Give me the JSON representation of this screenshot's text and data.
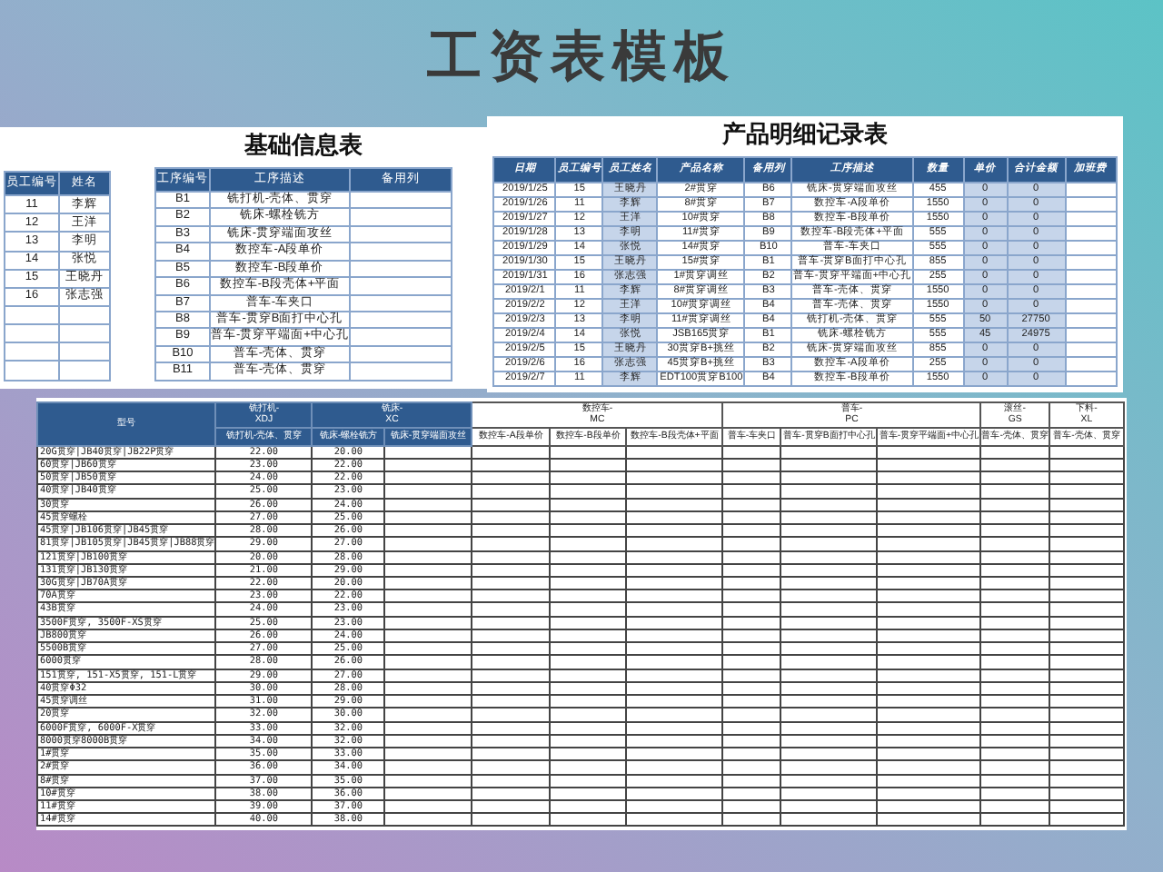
{
  "title": "工资表模板",
  "basic_info": {
    "title": "基础信息表",
    "employees": {
      "columns": [
        "员工编号",
        "姓名"
      ],
      "rows": [
        [
          "11",
          "李辉"
        ],
        [
          "12",
          "王洋"
        ],
        [
          "13",
          "李明"
        ],
        [
          "14",
          "张悦"
        ],
        [
          "15",
          "王晓丹"
        ],
        [
          "16",
          "张志强"
        ]
      ]
    },
    "processes": {
      "columns": [
        "工序编号",
        "工序描述",
        "备用列"
      ],
      "rows": [
        [
          "B1",
          "铣打机-壳体、贯穿"
        ],
        [
          "B2",
          "铣床-螺栓铣方"
        ],
        [
          "B3",
          "铣床-贯穿端面攻丝"
        ],
        [
          "B4",
          "数控车-A段单价"
        ],
        [
          "B5",
          "数控车-B段单价"
        ],
        [
          "B6",
          "数控车-B段壳体+平面"
        ],
        [
          "B7",
          "普车-车夹口"
        ],
        [
          "B8",
          "普车-贯穿B面打中心孔"
        ],
        [
          "B9",
          "普车-贯穿平端面+中心孔"
        ],
        [
          "B10",
          "普车-壳体、贯穿"
        ],
        [
          "B11",
          "普车-壳体、贯穿"
        ]
      ]
    }
  },
  "product_log": {
    "title": "产品明细记录表",
    "columns": [
      {
        "label": "日期",
        "highlight": false
      },
      {
        "label": "员工编号",
        "highlight": false
      },
      {
        "label": "员工姓名",
        "highlight": true
      },
      {
        "label": "产品名称",
        "highlight": false
      },
      {
        "label": "备用列",
        "highlight": false
      },
      {
        "label": "工序描述",
        "highlight": false
      },
      {
        "label": "数量",
        "highlight": false
      },
      {
        "label": "单价",
        "highlight": true
      },
      {
        "label": "合计金额",
        "highlight": true
      },
      {
        "label": "加班费",
        "highlight": false
      }
    ],
    "rows": [
      [
        "2019/1/25",
        "15",
        "王晓丹",
        "2#贯穿",
        "B6",
        "铣床-贯穿端面攻丝",
        "455",
        "0",
        "0"
      ],
      [
        "2019/1/26",
        "11",
        "李辉",
        "8#贯穿",
        "B7",
        "数控车-A段单价",
        "1550",
        "0",
        "0"
      ],
      [
        "2019/1/27",
        "12",
        "王洋",
        "10#贯穿",
        "B8",
        "数控车-B段单价",
        "1550",
        "0",
        "0"
      ],
      [
        "2019/1/28",
        "13",
        "李明",
        "11#贯穿",
        "B9",
        "数控车-B段壳体+平面",
        "555",
        "0",
        "0"
      ],
      [
        "2019/1/29",
        "14",
        "张悦",
        "14#贯穿",
        "B10",
        "普车-车夹口",
        "555",
        "0",
        "0"
      ],
      [
        "2019/1/30",
        "15",
        "王晓丹",
        "15#贯穿",
        "B1",
        "普车-贯穿B面打中心孔",
        "855",
        "0",
        "0"
      ],
      [
        "2019/1/31",
        "16",
        "张志强",
        "1#贯穿调丝",
        "B2",
        "普车-贯穿平端面+中心孔",
        "255",
        "0",
        "0"
      ],
      [
        "2019/2/1",
        "11",
        "李辉",
        "8#贯穿调丝",
        "B3",
        "普车-壳体、贯穿",
        "1550",
        "0",
        "0"
      ],
      [
        "2019/2/2",
        "12",
        "王洋",
        "10#贯穿调丝",
        "B4",
        "普车-壳体、贯穿",
        "1550",
        "0",
        "0"
      ],
      [
        "2019/2/3",
        "13",
        "李明",
        "11#贯穿调丝",
        "B4",
        "铣打机-壳体、贯穿",
        "555",
        "50",
        "27750"
      ],
      [
        "2019/2/4",
        "14",
        "张悦",
        "JSB165贯穿",
        "B1",
        "铣床-螺栓铣方",
        "555",
        "45",
        "24975"
      ],
      [
        "2019/2/5",
        "15",
        "王晓丹",
        "30贯穿B+挑丝",
        "B2",
        "铣床-贯穿端面攻丝",
        "855",
        "0",
        "0"
      ],
      [
        "2019/2/6",
        "16",
        "张志强",
        "45贯穿B+挑丝",
        "B3",
        "数控车-A段单价",
        "255",
        "0",
        "0"
      ],
      [
        "2019/2/7",
        "11",
        "李辉",
        "EDT100贯穿B100",
        "B4",
        "数控车-B段单价",
        "1550",
        "0",
        "0"
      ]
    ]
  },
  "price_table": {
    "model_header": "型号",
    "groups": [
      {
        "name": "铣打机-",
        "code": "XDJ",
        "kind": "dark",
        "columns": [
          "铣打机-壳体、贯穿"
        ]
      },
      {
        "name": "铣床-",
        "code": "XC",
        "kind": "dark",
        "columns": [
          "铣床-螺栓铣方",
          "铣床-贯穿端面攻丝"
        ]
      },
      {
        "name": "数控车-",
        "code": "MC",
        "kind": "light",
        "columns": [
          "数控车-A段单价",
          "数控车-B段单价",
          "数控车-B段壳体+平面"
        ]
      },
      {
        "name": "普车-",
        "code": "PC",
        "kind": "light",
        "columns": [
          "普车-车夹口",
          "普车-贯穿B面打中心孔",
          "普车-贯穿平端面+中心孔"
        ]
      },
      {
        "name": "滚丝-",
        "code": "GS",
        "kind": "light",
        "columns": [
          "普车-壳体、贯穿"
        ]
      },
      {
        "name": "下料-",
        "code": "XL",
        "kind": "light",
        "columns": [
          "普车-壳体、贯穿"
        ]
      }
    ],
    "rows": [
      {
        "model": "20G贯穿|JB40贯穿|JB22P贯穿",
        "values": [
          "22.00",
          "20.00"
        ]
      },
      {
        "model": "60贯穿|JB60贯穿",
        "values": [
          "23.00",
          "22.00"
        ]
      },
      {
        "model": "50贯穿|JB50贯穿",
        "values": [
          "24.00",
          "22.00"
        ]
      },
      {
        "model": "40贯穿|JB40贯穿",
        "values": [
          "25.00",
          "23.00"
        ]
      },
      {
        "model": "30贯穿",
        "values": [
          "26.00",
          "24.00"
        ]
      },
      {
        "model": "45贯穿螺栓",
        "values": [
          "27.00",
          "25.00"
        ]
      },
      {
        "model": "45贯穿|JB106贯穿|JB45贯穿",
        "values": [
          "28.00",
          "26.00"
        ]
      },
      {
        "model": "81贯穿|JB105贯穿|JB45贯穿|JB88贯穿",
        "values": [
          "29.00",
          "27.00"
        ]
      },
      {
        "model": "121贯穿|JB100贯穿",
        "values": [
          "20.00",
          "28.00"
        ]
      },
      {
        "model": "131贯穿|JB130贯穿",
        "values": [
          "21.00",
          "29.00"
        ]
      },
      {
        "model": "30G贯穿|JB70A贯穿",
        "values": [
          "22.00",
          "20.00"
        ]
      },
      {
        "model": "70A贯穿",
        "values": [
          "23.00",
          "22.00"
        ]
      },
      {
        "model": "43B贯穿",
        "values": [
          "24.00",
          "23.00"
        ]
      },
      {
        "model": "3500F贯穿, 3500F-XS贯穿",
        "values": [
          "25.00",
          "23.00"
        ]
      },
      {
        "model": "JB800贯穿",
        "values": [
          "26.00",
          "24.00"
        ]
      },
      {
        "model": "5500B贯穿",
        "values": [
          "27.00",
          "25.00"
        ]
      },
      {
        "model": "6000贯穿",
        "values": [
          "28.00",
          "26.00"
        ]
      },
      {
        "model": "151贯穿, 151-X5贯穿, 151-L贯穿",
        "values": [
          "29.00",
          "27.00"
        ]
      },
      {
        "model": "40贯穿Φ32",
        "values": [
          "30.00",
          "28.00"
        ]
      },
      {
        "model": "45贯穿调丝",
        "values": [
          "31.00",
          "29.00"
        ]
      },
      {
        "model": "20贯穿",
        "values": [
          "32.00",
          "30.00"
        ]
      },
      {
        "model": "6000F贯穿, 6000F-X贯穿",
        "values": [
          "33.00",
          "32.00"
        ]
      },
      {
        "model": "8000贯穿8000B贯穿",
        "values": [
          "34.00",
          "32.00"
        ]
      },
      {
        "model": "1#贯穿",
        "values": [
          "35.00",
          "33.00"
        ]
      },
      {
        "model": "2#贯穿",
        "values": [
          "36.00",
          "34.00"
        ]
      },
      {
        "model": "8#贯穿",
        "values": [
          "37.00",
          "35.00"
        ]
      },
      {
        "model": "10#贯穿",
        "values": [
          "38.00",
          "36.00"
        ]
      },
      {
        "model": "11#贯穿",
        "values": [
          "39.00",
          "37.00"
        ]
      },
      {
        "model": "14#贯穿",
        "values": [
          "40.00",
          "38.00"
        ]
      }
    ]
  }
}
